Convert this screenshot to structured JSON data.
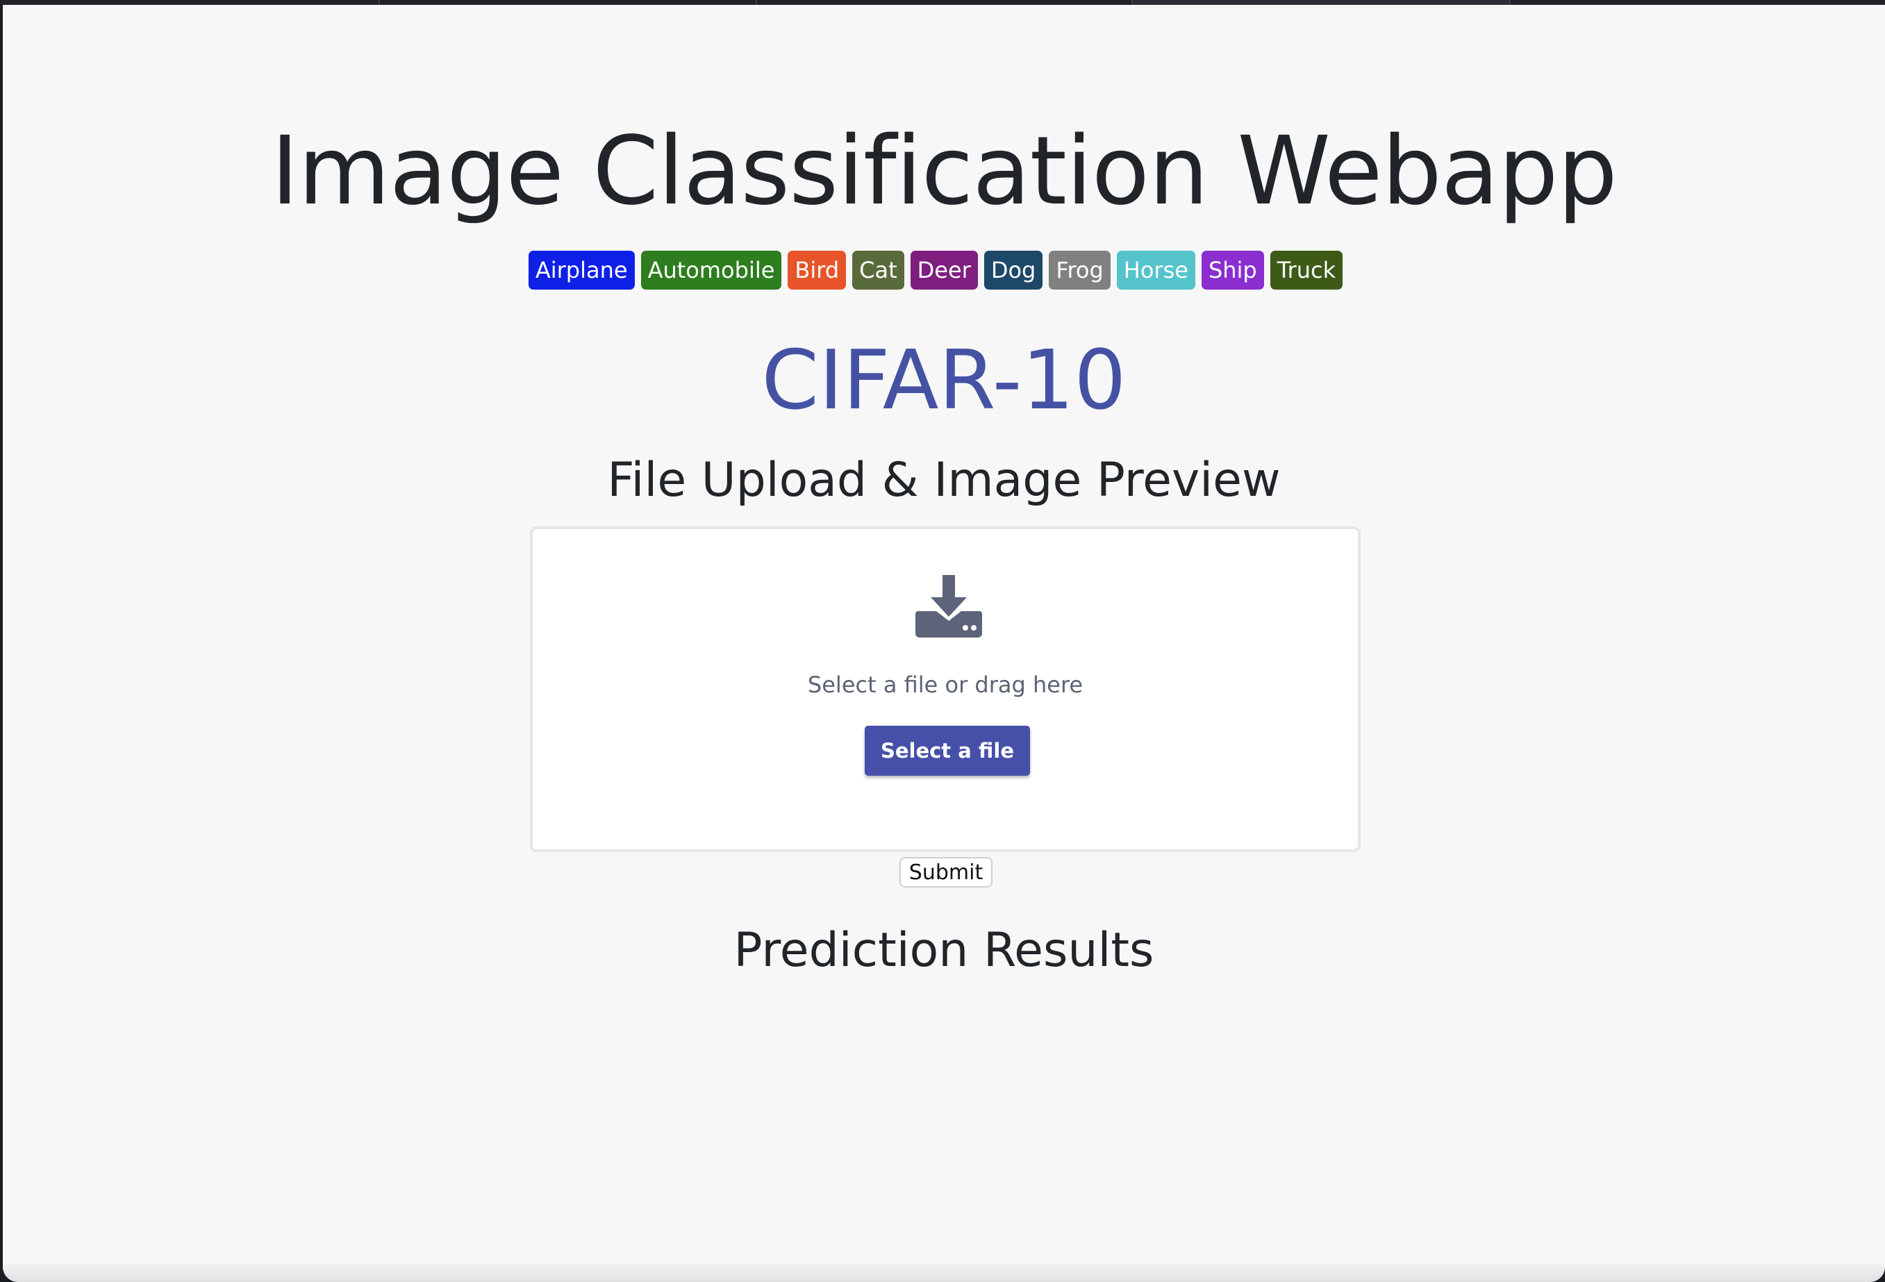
{
  "page": {
    "title": "Image Classification Webapp",
    "dataset": "CIFAR-10",
    "upload_heading": "File Upload & Image Preview",
    "results_heading": "Prediction Results"
  },
  "badges": [
    {
      "label": "Airplane",
      "color": "#0f20e6"
    },
    {
      "label": "Automobile",
      "color": "#2e7d1e"
    },
    {
      "label": "Bird",
      "color": "#e8542a"
    },
    {
      "label": "Cat",
      "color": "#5a6b3b"
    },
    {
      "label": "Deer",
      "color": "#7e1e7f"
    },
    {
      "label": "Dog",
      "color": "#1d4868"
    },
    {
      "label": "Frog",
      "color": "#808080"
    },
    {
      "label": "Horse",
      "color": "#54c3cc"
    },
    {
      "label": "Ship",
      "color": "#8a2ed0"
    },
    {
      "label": "Truck",
      "color": "#3d5a17"
    }
  ],
  "upload": {
    "icon": "download-icon",
    "hint": "Select a file or drag here",
    "select_label": "Select a file",
    "submit_label": "Submit"
  },
  "colors": {
    "accent": "#4650a8",
    "dataset_title": "#4552a4",
    "icon": "#5d6379"
  }
}
